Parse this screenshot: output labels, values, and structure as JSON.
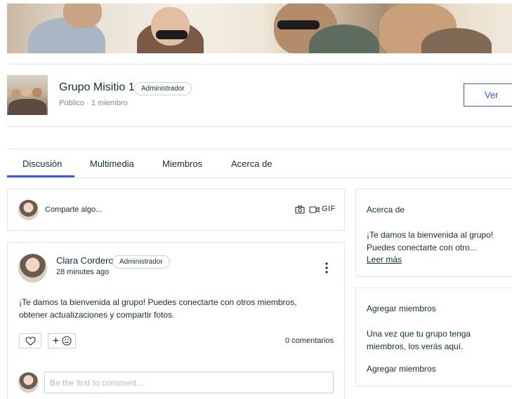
{
  "group": {
    "name": "Grupo Misitio 1",
    "role_badge": "Administrador",
    "meta": "Público · 1 miembro",
    "view_button": "Ver"
  },
  "tabs": [
    {
      "label": "Discusión",
      "active": true
    },
    {
      "label": "Multimedia",
      "active": false
    },
    {
      "label": "Miembros",
      "active": false
    },
    {
      "label": "Acerca de",
      "active": false
    }
  ],
  "composer": {
    "placeholder": "Comparte algo...",
    "icons": [
      "camera-icon",
      "video-icon",
      "gif-icon"
    ],
    "gif_label": "GIF"
  },
  "post": {
    "author": "Clara Cordero",
    "author_badge": "Administrador",
    "time": "28 minutes ago",
    "body_line1": "¡Te damos la bienvenida al grupo! Puedes conectarte con otros miembros,",
    "body_line2": "obtener actualizaciones y compartir fotos.",
    "comments_count": "0 comentarios",
    "comment_placeholder": "Be the first to comment..."
  },
  "about_card": {
    "title": "Acerca de",
    "text_line1": "¡Te damos la bienvenida al grupo!",
    "text_line2": "Puedes conectarte con otro...",
    "read_more": "Leer más"
  },
  "add_members_card": {
    "title": "Agregar miembros",
    "text_line1": "Una vez que tu grupo tenga",
    "text_line2": "miembros, los verás aquí.",
    "link": "Agregar miembros"
  },
  "colors": {
    "accent": "#3858e9",
    "text": "#162d3d",
    "muted": "#7a8a99",
    "border": "#dfe5eb"
  }
}
